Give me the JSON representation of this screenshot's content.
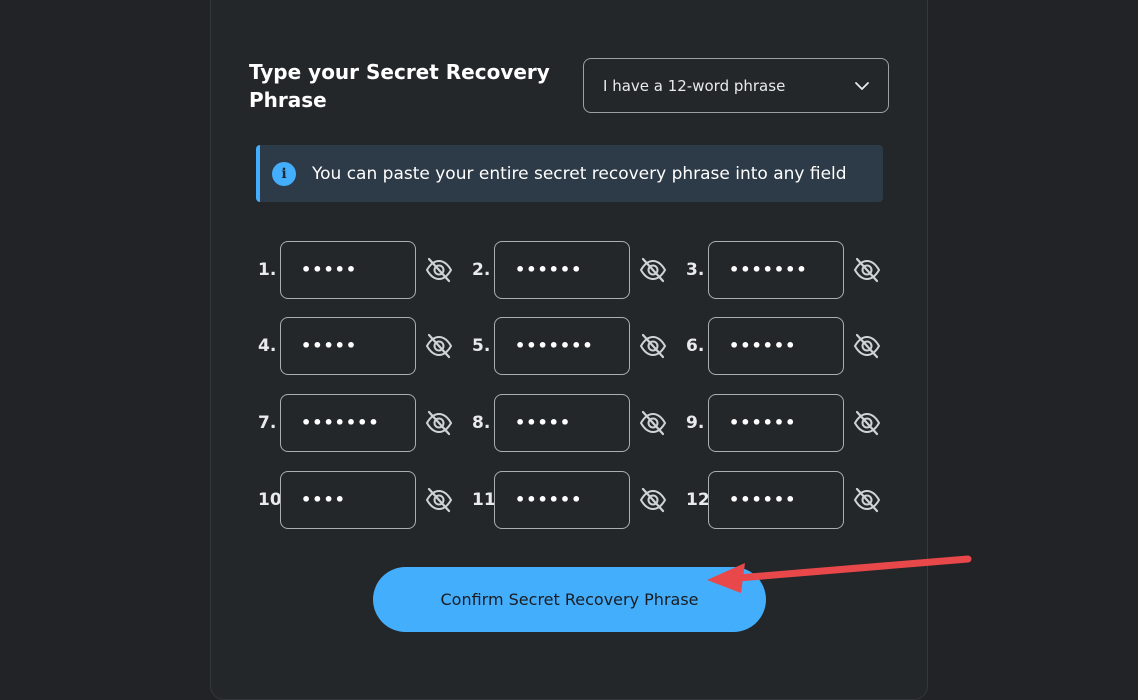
{
  "header": {
    "title": "Type your Secret Recovery Phrase"
  },
  "phrase_length_select": {
    "selected": "I have a 12-word phrase"
  },
  "banner": {
    "message": "You can paste your entire secret recovery phrase into any field",
    "icon": "info-icon"
  },
  "words": [
    {
      "label": "1.",
      "masked": "•••••"
    },
    {
      "label": "2.",
      "masked": "••••••"
    },
    {
      "label": "3.",
      "masked": "•••••••"
    },
    {
      "label": "4.",
      "masked": "•••••"
    },
    {
      "label": "5.",
      "masked": "•••••••"
    },
    {
      "label": "6.",
      "masked": "••••••"
    },
    {
      "label": "7.",
      "masked": "•••••••"
    },
    {
      "label": "8.",
      "masked": "•••••"
    },
    {
      "label": "9.",
      "masked": "••••••"
    },
    {
      "label": "10.",
      "masked": "••••"
    },
    {
      "label": "11.",
      "masked": "••••••"
    },
    {
      "label": "12.",
      "masked": "••••••"
    }
  ],
  "confirm_button": {
    "label": "Confirm Secret Recovery Phrase"
  },
  "colors": {
    "accent": "#43aefc",
    "background": "#222326",
    "annotation_arrow": "#e8484a"
  }
}
